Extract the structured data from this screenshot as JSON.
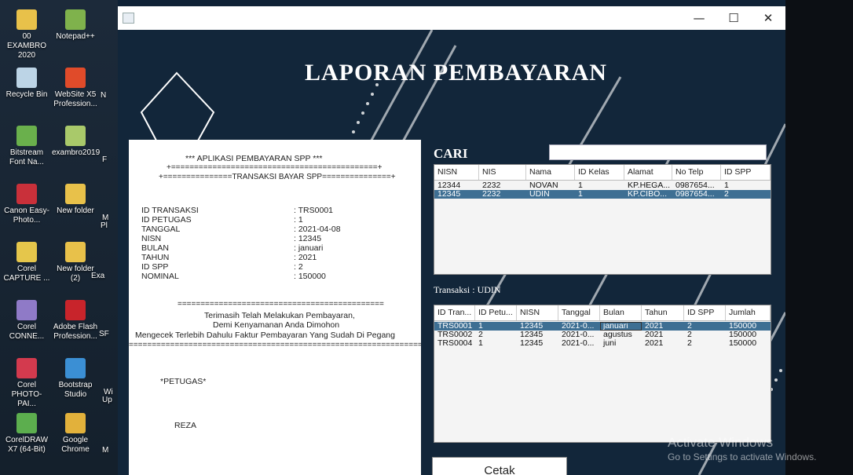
{
  "desktop": {
    "icons": [
      {
        "label": "00 EXAMBRO 2020",
        "icon": "folder-icon",
        "color": "#e8c14a"
      },
      {
        "label": "Notepad++",
        "icon": "notepad-icon",
        "color": "#7fb24c"
      },
      {
        "label": "Recycle Bin",
        "icon": "recycle-bin-icon",
        "color": "#bcd4e6"
      },
      {
        "label": "WebSite X5 Profession...",
        "icon": "websitex5-icon",
        "color": "#e04b2a"
      },
      {
        "label": "Bitstream Font Na...",
        "icon": "bitstream-icon",
        "color": "#6ab04c"
      },
      {
        "label": "exambro2019",
        "icon": "folder-icon",
        "color": "#a9c96a"
      },
      {
        "label": "Canon Easy-Photo...",
        "icon": "canon-icon",
        "color": "#c9303a"
      },
      {
        "label": "New folder",
        "icon": "folder-icon",
        "color": "#e8c14a"
      },
      {
        "label": "Corel CAPTURE ...",
        "icon": "corel-capture-icon",
        "color": "#e5c64b"
      },
      {
        "label": "New folder (2)",
        "icon": "folder-icon",
        "color": "#e8c14a"
      },
      {
        "label": "Corel CONNE...",
        "icon": "corel-connect-icon",
        "color": "#8f7ac7"
      },
      {
        "label": "Adobe Flash Profession...",
        "icon": "adobe-flash-icon",
        "color": "#c8242b"
      },
      {
        "label": "Corel PHOTO-PAI...",
        "icon": "corel-photopaint-icon",
        "color": "#d33a4e"
      },
      {
        "label": "Bootstrap Studio",
        "icon": "bootstrap-studio-icon",
        "color": "#3b8fd4"
      },
      {
        "label": "CorelDRAW X7 (64-Bit)",
        "icon": "coreldraw-icon",
        "color": "#5cae4e"
      },
      {
        "label": "Google Chrome",
        "icon": "chrome-icon",
        "color": "#e2b13b"
      }
    ],
    "cut_labels": [
      "N",
      "F",
      "M",
      "Pl",
      "Exa",
      "SF",
      "Wi",
      "Up",
      "M"
    ]
  },
  "window": {
    "minimize": "—",
    "maximize": "☐",
    "close": "✕"
  },
  "headline": "LAPORAN PEMBAYARAN",
  "receipt": {
    "app_title": "*** APLIKASI PEMBAYARAN SPP ***",
    "rule1": "+=============================================+",
    "rule2": "+===============TRANSAKSI BAYAR SPP===============+",
    "fields": [
      {
        "label": "ID TRANSAKSI",
        "value": ": TRS0001"
      },
      {
        "label": "ID PETUGAS",
        "value": ": 1"
      },
      {
        "label": "TANGGAL",
        "value": ": 2021-04-08"
      },
      {
        "label": "NISN",
        "value": ": 12345"
      },
      {
        "label": "BULAN",
        "value": ": januari"
      },
      {
        "label": "TAHUN",
        "value": ": 2021"
      },
      {
        "label": "ID SPP",
        "value": ": 2"
      },
      {
        "label": "NOMINAL",
        "value": ": 150000"
      }
    ],
    "rule3": "=============================================",
    "thanks1": "Terimasih Telah Melakukan Pembayaran,",
    "thanks2": "Demi Kenyamanan Anda Dimohon",
    "thanks3": "Mengecek Terlebih Dahulu Faktur Pembayaran Yang Sudah Di Pegang",
    "rule4": "================================================================",
    "petugas_label": "*PETUGAS*",
    "petugas_name": "REZA"
  },
  "search": {
    "label": "CARI",
    "value": ""
  },
  "siswa_table": {
    "columns": [
      "NISN",
      "NIS",
      "Nama",
      "ID Kelas",
      "Alamat",
      "No Telp",
      "ID SPP"
    ],
    "rows": [
      [
        "12344",
        "2232",
        "NOVAN",
        "1",
        "KP.HEGA...",
        "0987654...",
        "1"
      ],
      [
        "12345",
        "2232",
        "UDIN",
        "1",
        "KP.CIBO...",
        "0987654...",
        "2"
      ]
    ],
    "selected_row": 1
  },
  "transaksi_label": "Transaksi :  UDIN",
  "transaksi_table": {
    "columns": [
      "ID Tran...",
      "ID Petu...",
      "NISN",
      "Tanggal",
      "Bulan",
      "Tahun",
      "ID SPP",
      "Jumlah"
    ],
    "rows": [
      [
        "TRS0001",
        "1",
        "12345",
        "2021-0...",
        "januari",
        "2021",
        "2",
        "150000"
      ],
      [
        "TRS0002",
        "2",
        "12345",
        "2021-0...",
        "agustus",
        "2021",
        "2",
        "150000"
      ],
      [
        "TRS0004",
        "1",
        "12345",
        "2021-0...",
        "juni",
        "2021",
        "2",
        "150000"
      ]
    ],
    "selected_row": 0
  },
  "cetak_label": "Cetak",
  "watermark": {
    "line1": "Activate Windows",
    "line2": "Go to Settings to activate Windows."
  }
}
